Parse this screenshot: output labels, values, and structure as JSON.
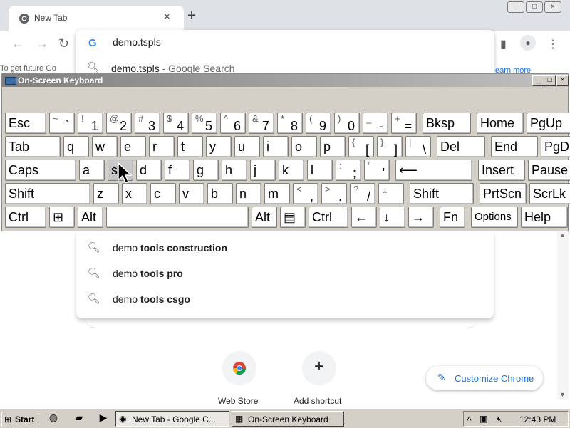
{
  "browser": {
    "tab_title": "New Tab",
    "tab_close": "×",
    "new_tab": "+",
    "window_buttons": [
      "−",
      "□",
      "×"
    ],
    "nav": {
      "back": "←",
      "forward": "→",
      "reload": "↻"
    },
    "omnibox": {
      "google_letter": "G",
      "value": "demo.tspls",
      "first_suggestion_main": "demo.tspls",
      "first_suggestion_sub": " - Google Search"
    },
    "left_partial_text": "To get future Go",
    "learn_more_partial": "earn more",
    "toolbar_icons": {
      "sidepanel": "▮",
      "profile": "●",
      "menu": "⋮"
    }
  },
  "suggestions": [
    {
      "prefix": "demo ",
      "bold": "tools construction"
    },
    {
      "prefix": "demo ",
      "bold": "tools pro"
    },
    {
      "prefix": "demo ",
      "bold": "tools csgo"
    }
  ],
  "ntp": {
    "shortcut_add": "+",
    "shortcut_labels": [
      "Web Store",
      "Add shortcut"
    ],
    "customize_label": "Customize Chrome"
  },
  "osk": {
    "title": "On-Screen Keyboard",
    "controls": [
      "_",
      "□",
      "×"
    ],
    "rows": [
      [
        {
          "n": "key-esc",
          "l": "Esc"
        },
        {
          "n": "key-backtick",
          "s": "~",
          "b": "`"
        },
        {
          "n": "key-1",
          "s": "!",
          "b": "1"
        },
        {
          "n": "key-2",
          "s": "@",
          "b": "2"
        },
        {
          "n": "key-3",
          "s": "#",
          "b": "3"
        },
        {
          "n": "key-4",
          "s": "$",
          "b": "4"
        },
        {
          "n": "key-5",
          "s": "%",
          "b": "5"
        },
        {
          "n": "key-6",
          "s": "^",
          "b": "6"
        },
        {
          "n": "key-7",
          "s": "&",
          "b": "7"
        },
        {
          "n": "key-8",
          "s": "*",
          "b": "8"
        },
        {
          "n": "key-9",
          "s": "(",
          "b": "9"
        },
        {
          "n": "key-0",
          "s": ")",
          "b": "0"
        },
        {
          "n": "key-minus",
          "s": "_",
          "b": "-"
        },
        {
          "n": "key-equals",
          "s": "+",
          "b": "="
        },
        {
          "n": "key-backspace",
          "l": "Bksp"
        },
        {
          "n": "key-home",
          "l": "Home"
        },
        {
          "n": "key-pgup",
          "l": "PgUp"
        }
      ],
      [
        {
          "n": "key-tab",
          "l": "Tab"
        },
        {
          "n": "key-q",
          "l": "q"
        },
        {
          "n": "key-w",
          "l": "w"
        },
        {
          "n": "key-e",
          "l": "e"
        },
        {
          "n": "key-r",
          "l": "r"
        },
        {
          "n": "key-t",
          "l": "t"
        },
        {
          "n": "key-y",
          "l": "y"
        },
        {
          "n": "key-u",
          "l": "u"
        },
        {
          "n": "key-i",
          "l": "i"
        },
        {
          "n": "key-o",
          "l": "o"
        },
        {
          "n": "key-p",
          "l": "p"
        },
        {
          "n": "key-lbracket",
          "s": "{",
          "b": "["
        },
        {
          "n": "key-rbracket",
          "s": "}",
          "b": "]"
        },
        {
          "n": "key-backslash",
          "s": "|",
          "b": "\\"
        },
        {
          "n": "key-del",
          "l": "Del"
        },
        {
          "n": "key-end",
          "l": "End"
        },
        {
          "n": "key-pgdn",
          "l": "PgDn"
        }
      ],
      [
        {
          "n": "key-caps",
          "l": "Caps"
        },
        {
          "n": "key-a",
          "l": "a"
        },
        {
          "n": "key-s",
          "l": "s"
        },
        {
          "n": "key-d",
          "l": "d"
        },
        {
          "n": "key-f",
          "l": "f"
        },
        {
          "n": "key-g",
          "l": "g"
        },
        {
          "n": "key-h",
          "l": "h"
        },
        {
          "n": "key-j",
          "l": "j"
        },
        {
          "n": "key-k",
          "l": "k"
        },
        {
          "n": "key-l",
          "l": "l"
        },
        {
          "n": "key-semicolon",
          "s": ":",
          "b": ";"
        },
        {
          "n": "key-quote",
          "s": "\"",
          "b": "'"
        },
        {
          "n": "key-enter",
          "l": "⟵"
        },
        {
          "n": "key-insert",
          "l": "Insert"
        },
        {
          "n": "key-pause",
          "l": "Pause"
        }
      ],
      [
        {
          "n": "key-shift-left",
          "l": "Shift"
        },
        {
          "n": "key-z",
          "l": "z"
        },
        {
          "n": "key-x",
          "l": "x"
        },
        {
          "n": "key-c",
          "l": "c"
        },
        {
          "n": "key-v",
          "l": "v"
        },
        {
          "n": "key-b",
          "l": "b"
        },
        {
          "n": "key-n",
          "l": "n"
        },
        {
          "n": "key-m",
          "l": "m"
        },
        {
          "n": "key-comma",
          "s": "<",
          "b": ","
        },
        {
          "n": "key-period",
          "s": ">",
          "b": "."
        },
        {
          "n": "key-slash",
          "s": "?",
          "b": "/"
        },
        {
          "n": "key-up",
          "l": "↑"
        },
        {
          "n": "key-shift-right",
          "l": "Shift"
        },
        {
          "n": "key-prtscn",
          "l": "PrtScn"
        },
        {
          "n": "key-scrlk",
          "l": "ScrLk"
        }
      ],
      [
        {
          "n": "key-ctrl-left",
          "l": "Ctrl"
        },
        {
          "n": "key-win",
          "l": "⊞"
        },
        {
          "n": "key-alt-left",
          "l": "Alt"
        },
        {
          "n": "key-space",
          "l": ""
        },
        {
          "n": "key-alt-right",
          "l": "Alt"
        },
        {
          "n": "key-menu",
          "l": "▤"
        },
        {
          "n": "key-ctrl-right",
          "l": "Ctrl"
        },
        {
          "n": "key-left",
          "l": "←"
        },
        {
          "n": "key-down",
          "l": "↓"
        },
        {
          "n": "key-right",
          "l": "→"
        },
        {
          "n": "key-fn",
          "l": "Fn"
        },
        {
          "n": "key-options",
          "l": "Options"
        },
        {
          "n": "key-help",
          "l": "Help"
        }
      ]
    ]
  },
  "taskbar": {
    "start_label": "Start",
    "tasks": [
      {
        "label": "New Tab - Google C...",
        "icon": "◉"
      },
      {
        "label": "On-Screen Keyboard",
        "icon": "▦"
      }
    ],
    "clock": "12:43 PM"
  }
}
